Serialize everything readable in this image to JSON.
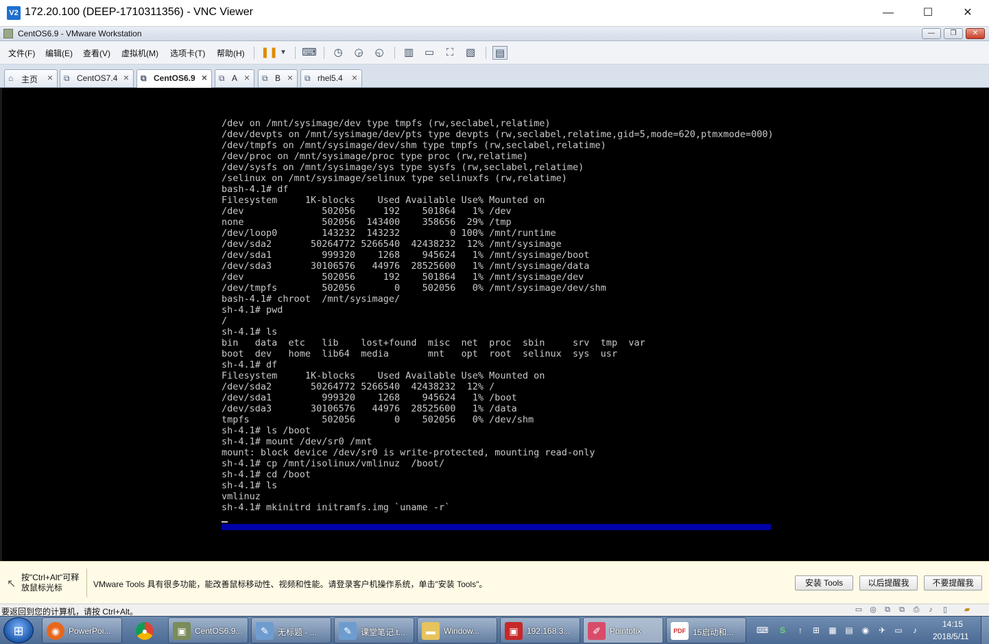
{
  "vnc": {
    "title": "172.20.100 (DEEP-1710311356) - VNC Viewer",
    "icon": "V2",
    "buttons": {
      "minimize": "—",
      "maximize": "☐",
      "close": "✕"
    }
  },
  "vmware": {
    "title": "CentOS6.9 - VMware Workstation",
    "window_buttons": {
      "minimize": "—",
      "restore": "❐",
      "close": "✕"
    }
  },
  "menu": {
    "items": [
      "文件(F)",
      "编辑(E)",
      "查看(V)",
      "虚拟机(M)",
      "选项卡(T)",
      "帮助(H)"
    ]
  },
  "tabs": [
    {
      "label": "主页",
      "icon": "home-icon",
      "active": false
    },
    {
      "label": "CentOS7.4",
      "icon": "vm-icon",
      "active": false
    },
    {
      "label": "CentOS6.9",
      "icon": "vm-icon",
      "active": true
    },
    {
      "label": "A",
      "icon": "vm-icon",
      "active": false
    },
    {
      "label": "B",
      "icon": "vm-icon",
      "active": false
    },
    {
      "label": "rhel5.4",
      "icon": "vm-icon",
      "active": false
    }
  ],
  "console": {
    "lines": [
      "/dev on /mnt/sysimage/dev type tmpfs (rw,seclabel,relatime)",
      "/dev/devpts on /mnt/sysimage/dev/pts type devpts (rw,seclabel,relatime,gid=5,mode=620,ptmxmode=000)",
      "/dev/tmpfs on /mnt/sysimage/dev/shm type tmpfs (rw,seclabel,relatime)",
      "/dev/proc on /mnt/sysimage/proc type proc (rw,relatime)",
      "/dev/sysfs on /mnt/sysimage/sys type sysfs (rw,seclabel,relatime)",
      "/selinux on /mnt/sysimage/selinux type selinuxfs (rw,relatime)",
      "bash-4.1# df",
      "Filesystem     1K-blocks    Used Available Use% Mounted on",
      "/dev              502056     192    501864   1% /dev",
      "none              502056  143400    358656  29% /tmp",
      "/dev/loop0        143232  143232         0 100% /mnt/runtime",
      "/dev/sda2       50264772 5266540  42438232  12% /mnt/sysimage",
      "/dev/sda1         999320    1268    945624   1% /mnt/sysimage/boot",
      "/dev/sda3       30106576   44976  28525600   1% /mnt/sysimage/data",
      "/dev              502056     192    501864   1% /mnt/sysimage/dev",
      "/dev/tmpfs        502056       0    502056   0% /mnt/sysimage/dev/shm",
      "bash-4.1# chroot  /mnt/sysimage/",
      "sh-4.1# pwd",
      "/",
      "sh-4.1# ls",
      "bin   data  etc   lib    lost+found  misc  net  proc  sbin     srv  tmp  var",
      "boot  dev   home  lib64  media       mnt   opt  root  selinux  sys  usr",
      "sh-4.1# df",
      "Filesystem     1K-blocks    Used Available Use% Mounted on",
      "/dev/sda2       50264772 5266540  42438232  12% /",
      "/dev/sda1         999320    1268    945624   1% /boot",
      "/dev/sda3       30106576   44976  28525600   1% /data",
      "tmpfs             502056       0    502056   0% /dev/shm",
      "sh-4.1# ls /boot",
      "sh-4.1# mount /dev/sr0 /mnt",
      "mount: block device /dev/sr0 is write-protected, mounting read-only",
      "sh-4.1# cp /mnt/isolinux/vmlinuz  /boot/",
      "sh-4.1# cd /boot",
      "sh-4.1# ls",
      "vmlinuz",
      "sh-4.1# mkinitrd initramfs.img `uname -r`"
    ]
  },
  "notice": {
    "hint": "按\"Ctrl+Alt\"可释放鼠标光标",
    "message": "VMware Tools 具有很多功能，能改善鼠标移动性、视频和性能。请登录客户机操作系统，单击\"安装 Tools\"。",
    "install_label": "安装 Tools",
    "later_label": "以后提醒我",
    "never_label": "不要提醒我"
  },
  "status": {
    "text": "要返回到您的计算机，请按 Ctrl+Alt。"
  },
  "taskbar": {
    "items": [
      {
        "label": "PowerPoi...",
        "icon": "firefox-icon",
        "color": "#e8671c"
      },
      {
        "label": "",
        "icon": "chrome-icon",
        "color": "#2f9e44"
      },
      {
        "label": "CentOS6.9...",
        "icon": "vmware-icon",
        "color": "#7a8c5a"
      },
      {
        "label": "无标题 - ...",
        "icon": "notepad-icon",
        "color": "#6e9ccf"
      },
      {
        "label": "课堂笔记.t...",
        "icon": "notepad-icon",
        "color": "#6e9ccf"
      },
      {
        "label": "Window...",
        "icon": "folder-icon",
        "color": "#e6c35c"
      },
      {
        "label": "192.168.3...",
        "icon": "vnc-icon",
        "color": "#c62828"
      },
      {
        "label": "Pointofix",
        "icon": "pointofix-icon",
        "color": "#d84c6a"
      },
      {
        "label": "15启动和...",
        "icon": "pdf-icon",
        "color": "#d32f2f"
      }
    ],
    "clock_time": "14:15",
    "clock_date": "2018/5/11"
  }
}
